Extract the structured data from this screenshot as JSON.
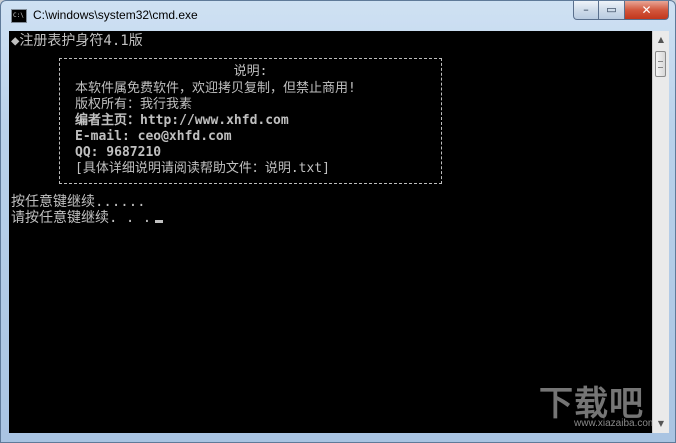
{
  "window": {
    "title": "C:\\windows\\system32\\cmd.exe",
    "icon_label": "C:\\",
    "buttons": {
      "minimize": "–",
      "maximize": "▭",
      "close": "✕"
    }
  },
  "console": {
    "header": "◆注册表护身符4.1版",
    "info_box": {
      "title": "说明:",
      "lines": [
        "本软件属免费软件，欢迎拷贝复制，但禁止商用!",
        "版权所有：我行我素",
        "编者主页：http://www.xhfd.com",
        "E-mail: ceo@xhfd.com",
        "QQ: 9687210",
        "[具体详细说明请阅读帮助文件：说明.txt]"
      ]
    },
    "after_lines": [
      "按任意键继续......",
      "请按任意键继续. . ."
    ]
  },
  "scrollbar": {
    "up_arrow": "▲",
    "down_arrow": "▼"
  },
  "watermark": {
    "main": "下载吧",
    "sub": "www.xiazaiba.com"
  }
}
